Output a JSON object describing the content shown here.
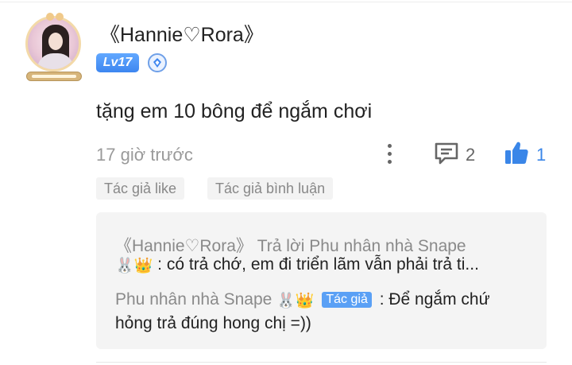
{
  "comment": {
    "username": "《Hannie♡Rora》",
    "level": "Lv17",
    "text": "tặng em 10 bông để ngắm chơi",
    "time": "17 giờ trước",
    "reply_count": "2",
    "like_count": "1",
    "tags": [
      "Tác giả like",
      "Tác giả bình luận"
    ],
    "like_color": "#3a86e8"
  },
  "replies": {
    "reply1": {
      "author": "《Hannie♡Rora》",
      "action": "Trả lời",
      "target": "Phu nhân nhà Snape",
      "target_emoji": "🐰👑",
      "text": ": có trả chớ, em đi triển lãm vẫn phải trả ti..."
    },
    "reply2": {
      "author": "Phu nhân nhà Snape",
      "author_emoji": "🐰👑",
      "badge": "Tác giả",
      "text_line1": ": Để ngắm chứ",
      "text_line2": "hỏng trả đúng hong chị =))"
    }
  }
}
